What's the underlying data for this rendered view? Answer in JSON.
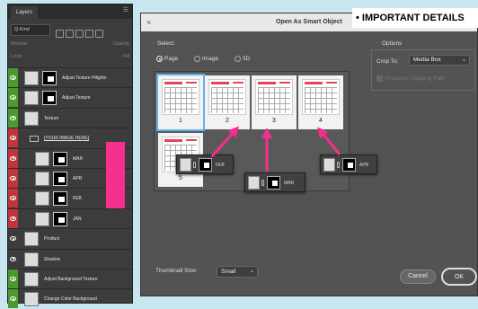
{
  "layers_panel": {
    "tab": "Layers",
    "kind": "Q Kind",
    "blend_mode": "Normal",
    "opacity_label": "Opacity",
    "lock_label": "Lock:",
    "fill_label": "Fill",
    "layers": [
      {
        "name": "Adjust Texture Hilights",
        "eye_color": "#4a9a2e"
      },
      {
        "name": "Adjust Texture",
        "eye_color": "#4a9a2e"
      },
      {
        "name": "Texture",
        "eye_color": "#4a9a2e"
      },
      {
        "name": "[YOUR IMAGE HERE]",
        "eye_color": "#c0353c"
      },
      {
        "name": "MAR",
        "eye_color": "#c0353c"
      },
      {
        "name": "APR",
        "eye_color": "#c0353c"
      },
      {
        "name": "FEB",
        "eye_color": "#c0353c"
      },
      {
        "name": "JAN",
        "eye_color": "#c0353c"
      },
      {
        "name": "Product",
        "eye_color": "#3c3c3c"
      },
      {
        "name": "Shadow",
        "eye_color": "#3c3c3c"
      },
      {
        "name": "Adjust Background Texture",
        "eye_color": "#4a9a2e"
      },
      {
        "name": "Change Color Background",
        "eye_color": "#4a9a2e"
      }
    ]
  },
  "dialog": {
    "title": "Open As Smart Object",
    "overlay_text": "• IMPORTANT DETAILS",
    "select_label": "Select:",
    "radio_options": [
      "Page",
      "Image",
      "3D"
    ],
    "selected_radio": "Page",
    "pages": [
      "1",
      "2",
      "3",
      "4",
      "5"
    ],
    "selected_page": "1",
    "options_label": "Options",
    "crop_to_label": "Crop To:",
    "crop_to_value": "Media Box",
    "preserve_label": "Preserve Clipping Path",
    "thumbnail_size_label": "Thumbnail Size:",
    "thumbnail_size_value": "Small",
    "cancel_label": "Cancel",
    "ok_label": "OK"
  },
  "chips": [
    "FEB",
    "MAR",
    "APR"
  ],
  "colors": {
    "arrow": "#f62e8d",
    "selection": "#5fb2f2"
  }
}
